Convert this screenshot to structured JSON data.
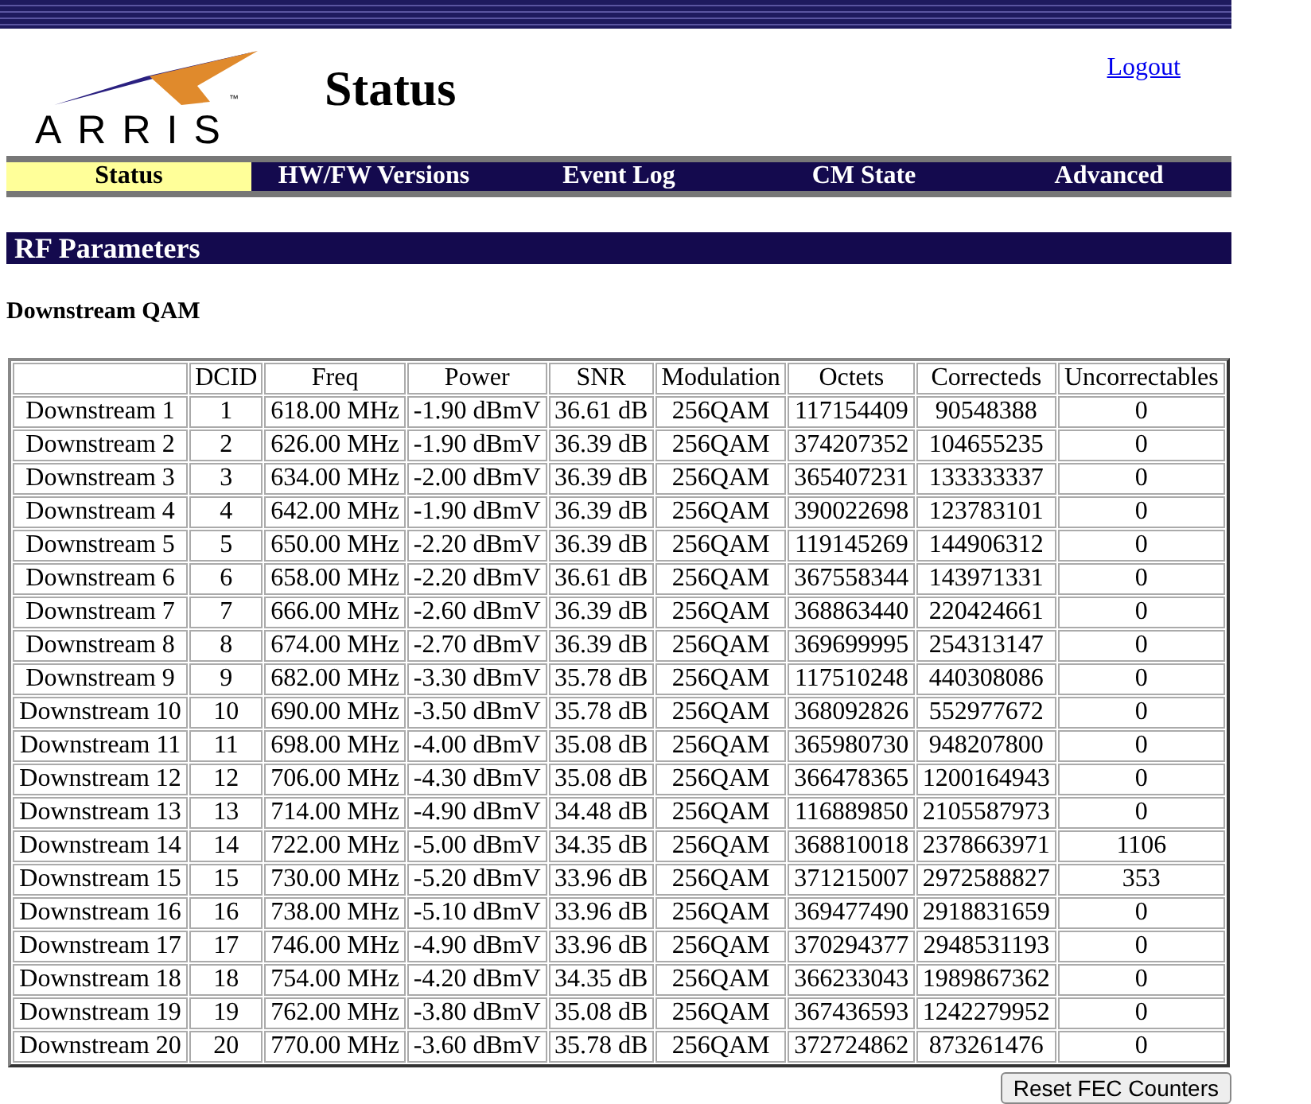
{
  "header": {
    "logo_text": "ARRIS",
    "logo_tm": "™",
    "title": "Status",
    "logout": "Logout"
  },
  "tabs": [
    {
      "label": "Status",
      "selected": true
    },
    {
      "label": "HW/FW Versions",
      "selected": false
    },
    {
      "label": "Event Log",
      "selected": false
    },
    {
      "label": "CM State",
      "selected": false
    },
    {
      "label": "Advanced",
      "selected": false
    }
  ],
  "section_title": "RF Parameters",
  "subsection_title": "Downstream QAM",
  "table": {
    "columns": [
      "",
      "DCID",
      "Freq",
      "Power",
      "SNR",
      "Modulation",
      "Octets",
      "Correcteds",
      "Uncorrectables"
    ],
    "rows": [
      [
        "Downstream 1",
        "1",
        "618.00 MHz",
        "-1.90 dBmV",
        "36.61 dB",
        "256QAM",
        "117154409",
        "90548388",
        "0"
      ],
      [
        "Downstream 2",
        "2",
        "626.00 MHz",
        "-1.90 dBmV",
        "36.39 dB",
        "256QAM",
        "374207352",
        "104655235",
        "0"
      ],
      [
        "Downstream 3",
        "3",
        "634.00 MHz",
        "-2.00 dBmV",
        "36.39 dB",
        "256QAM",
        "365407231",
        "133333337",
        "0"
      ],
      [
        "Downstream 4",
        "4",
        "642.00 MHz",
        "-1.90 dBmV",
        "36.39 dB",
        "256QAM",
        "390022698",
        "123783101",
        "0"
      ],
      [
        "Downstream 5",
        "5",
        "650.00 MHz",
        "-2.20 dBmV",
        "36.39 dB",
        "256QAM",
        "119145269",
        "144906312",
        "0"
      ],
      [
        "Downstream 6",
        "6",
        "658.00 MHz",
        "-2.20 dBmV",
        "36.61 dB",
        "256QAM",
        "367558344",
        "143971331",
        "0"
      ],
      [
        "Downstream 7",
        "7",
        "666.00 MHz",
        "-2.60 dBmV",
        "36.39 dB",
        "256QAM",
        "368863440",
        "220424661",
        "0"
      ],
      [
        "Downstream 8",
        "8",
        "674.00 MHz",
        "-2.70 dBmV",
        "36.39 dB",
        "256QAM",
        "369699995",
        "254313147",
        "0"
      ],
      [
        "Downstream 9",
        "9",
        "682.00 MHz",
        "-3.30 dBmV",
        "35.78 dB",
        "256QAM",
        "117510248",
        "440308086",
        "0"
      ],
      [
        "Downstream 10",
        "10",
        "690.00 MHz",
        "-3.50 dBmV",
        "35.78 dB",
        "256QAM",
        "368092826",
        "552977672",
        "0"
      ],
      [
        "Downstream 11",
        "11",
        "698.00 MHz",
        "-4.00 dBmV",
        "35.08 dB",
        "256QAM",
        "365980730",
        "948207800",
        "0"
      ],
      [
        "Downstream 12",
        "12",
        "706.00 MHz",
        "-4.30 dBmV",
        "35.08 dB",
        "256QAM",
        "366478365",
        "1200164943",
        "0"
      ],
      [
        "Downstream 13",
        "13",
        "714.00 MHz",
        "-4.90 dBmV",
        "34.48 dB",
        "256QAM",
        "116889850",
        "2105587973",
        "0"
      ],
      [
        "Downstream 14",
        "14",
        "722.00 MHz",
        "-5.00 dBmV",
        "34.35 dB",
        "256QAM",
        "368810018",
        "2378663971",
        "1106"
      ],
      [
        "Downstream 15",
        "15",
        "730.00 MHz",
        "-5.20 dBmV",
        "33.96 dB",
        "256QAM",
        "371215007",
        "2972588827",
        "353"
      ],
      [
        "Downstream 16",
        "16",
        "738.00 MHz",
        "-5.10 dBmV",
        "33.96 dB",
        "256QAM",
        "369477490",
        "2918831659",
        "0"
      ],
      [
        "Downstream 17",
        "17",
        "746.00 MHz",
        "-4.90 dBmV",
        "33.96 dB",
        "256QAM",
        "370294377",
        "2948531193",
        "0"
      ],
      [
        "Downstream 18",
        "18",
        "754.00 MHz",
        "-4.20 dBmV",
        "34.35 dB",
        "256QAM",
        "366233043",
        "1989867362",
        "0"
      ],
      [
        "Downstream 19",
        "19",
        "762.00 MHz",
        "-3.80 dBmV",
        "35.08 dB",
        "256QAM",
        "367436593",
        "1242279952",
        "0"
      ],
      [
        "Downstream 20",
        "20",
        "770.00 MHz",
        "-3.60 dBmV",
        "35.78 dB",
        "256QAM",
        "372724862",
        "873261476",
        "0"
      ]
    ]
  },
  "reset_button": "Reset FEC Counters"
}
